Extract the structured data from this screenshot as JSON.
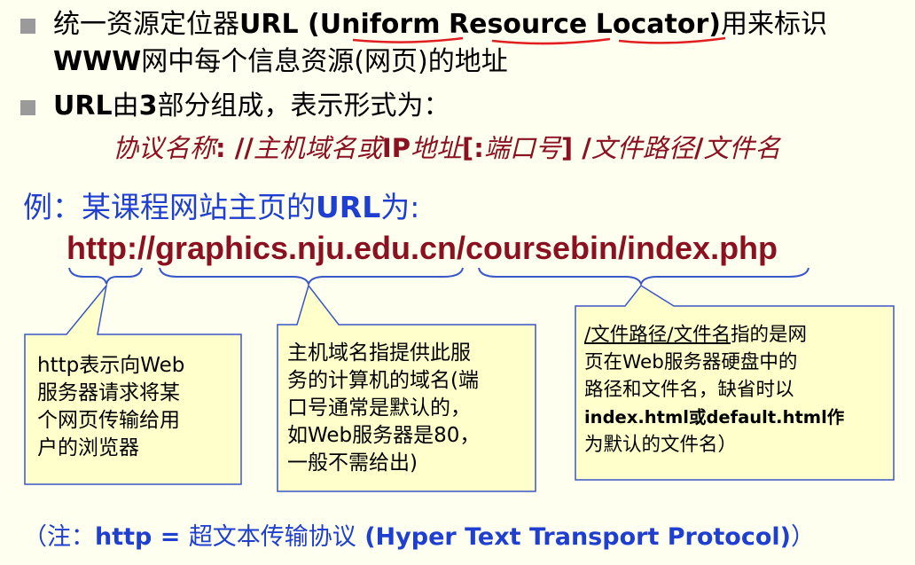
{
  "bullets": [
    {
      "line1_pre": "统一资源定位器",
      "line1_url": "URL (",
      "word_uniform": "Uniform",
      "word_resource": "Resource",
      "word_locator": "Locator",
      "line1_close": ")",
      "line1_post": "用来标识",
      "line2_www": "WWW",
      "line2_post": "网中每个信息资源(网页)的地址"
    },
    {
      "pre": "URL",
      "mid": "由",
      "num": "3",
      "post": "部分组成，表示形式为："
    }
  ],
  "format": {
    "protocol": "协议名称",
    "sep1": ": //",
    "host": "主机域名或",
    "ip": "IP",
    "addr": "地址",
    "port_open": "[:",
    "port": "端口号",
    "port_close": "] /",
    "path": "文件路径",
    "slash": "/",
    "file": "文件名"
  },
  "example": {
    "pre": "例：某课程网站主页的",
    "url_word": "URL",
    "post": "为:"
  },
  "url": "http://graphics.nju.edu.cn/coursebin/index.php",
  "callouts": {
    "protocol": {
      "lines": [
        "http表示向Web",
        "服务器请求将某",
        "个网页传输给用",
        "户的浏览器"
      ]
    },
    "host": {
      "lines": [
        "主机域名指提供此服",
        "务的计算机的域名(端",
        "口号通常是默认的，",
        "如Web服务器是80，",
        "一般不需给出)"
      ]
    },
    "path": {
      "title": "/文件路径/文件名",
      "line1_post": "指的是网",
      "lines": [
        "页在Web服务器硬盘中的",
        "路径和文件名，缺省时以",
        "index.html或default.html作",
        "为默认的文件名）"
      ]
    }
  },
  "note": {
    "open": "（注：",
    "http": "http",
    "eq": " = ",
    "cn": "超文本传输协议",
    "en": " (Hyper Text Transport Protocol)",
    "close": "）"
  },
  "colors": {
    "background": "#fffff0",
    "accent_red": "#8b1020",
    "accent_blue": "#1f3fd0",
    "callout_fill": "#ffffcc",
    "callout_border": "#3a57c8",
    "underline_red": "#e02020",
    "bullet_gray": "#9a9a9a"
  }
}
